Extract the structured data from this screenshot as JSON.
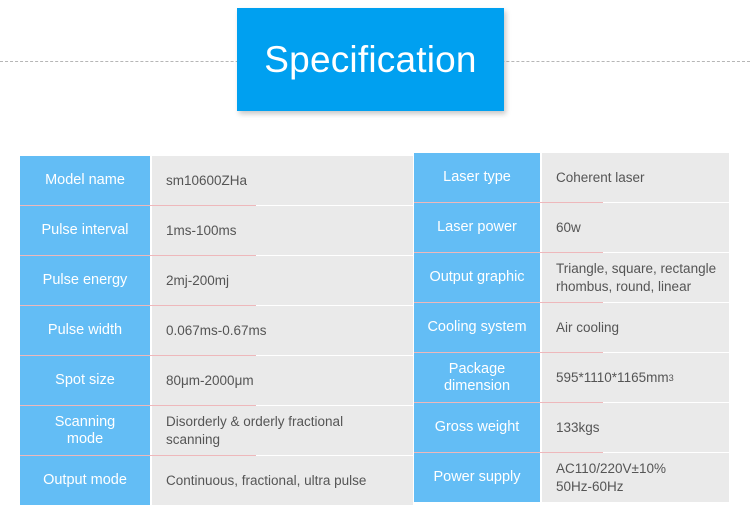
{
  "header": {
    "title": "Specification",
    "banner_color": "#00a0f0",
    "title_color": "#ffffff"
  },
  "theme": {
    "label_cell_color": "#63bdf5",
    "value_cell_color": "#eaeaea",
    "value_text_color": "#555555",
    "accent_line_color": "#e8a0a4"
  },
  "spec_tables": {
    "left": {
      "rows": [
        {
          "label": "Model name",
          "value": "sm10600ZHa"
        },
        {
          "label": "Pulse interval",
          "value": "1ms-100ms"
        },
        {
          "label": "Pulse energy",
          "value": "2mj-200mj"
        },
        {
          "label": "Pulse width",
          "value": " 0.067ms-0.67ms"
        },
        {
          "label": "Spot size",
          "value": "80μm-2000μm"
        },
        {
          "label": "Scanning\nmode",
          "value": "Disorderly & orderly fractional\nscanning"
        },
        {
          "label": "Output mode",
          "value": "Continuous, fractional, ultra pulse"
        }
      ]
    },
    "right": {
      "rows": [
        {
          "label": "Laser type",
          "value": "Coherent laser"
        },
        {
          "label": "Laser power",
          "value": "60w"
        },
        {
          "label": "Output graphic",
          "value": "Triangle, square, rectangle\nrhombus, round, linear"
        },
        {
          "label": "Cooling system",
          "value": "Air cooling"
        },
        {
          "label": "Package\ndimension",
          "value": "595*1110*1165mm",
          "value_sup": "3"
        },
        {
          "label": "Gross weight",
          "value": "133kgs"
        },
        {
          "label": "Power supply",
          "value": "AC110/220V±10%\n50Hz-60Hz"
        }
      ]
    }
  }
}
